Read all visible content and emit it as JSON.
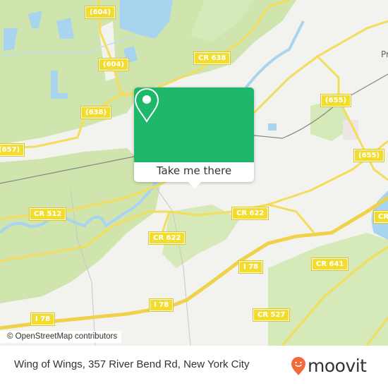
{
  "map": {
    "road_shields": [
      {
        "label": "(604)"
      },
      {
        "label": "(604)"
      },
      {
        "label": "CR 638"
      },
      {
        "label": "(638)"
      },
      {
        "label": "(657)"
      },
      {
        "label": "(655)"
      },
      {
        "label": "(655)"
      },
      {
        "label": "CR 512"
      },
      {
        "label": "CR 622"
      },
      {
        "label": "CR 622"
      },
      {
        "label": "I 78"
      },
      {
        "label": "I 78"
      },
      {
        "label": "I 78"
      },
      {
        "label": "CR 641"
      },
      {
        "label": "CR 527"
      },
      {
        "label": "CR"
      }
    ],
    "place_labels": [
      {
        "label": "Pr"
      }
    ],
    "attribution": "© OpenStreetMap contributors",
    "colors": {
      "background": "#f2f2ef",
      "forest": "#cfe5ad",
      "water": "#a8d4f0",
      "road": "#f4dc5c",
      "shield": "#f2dd2e"
    }
  },
  "popup": {
    "icon": "map-pin-icon",
    "cta_label": "Take me there",
    "color": "#1fb86a"
  },
  "footer": {
    "address": "Wing of Wings, 357 River Bend Rd, New York City",
    "brand": "moovit",
    "brand_color": "#f26a3a"
  }
}
